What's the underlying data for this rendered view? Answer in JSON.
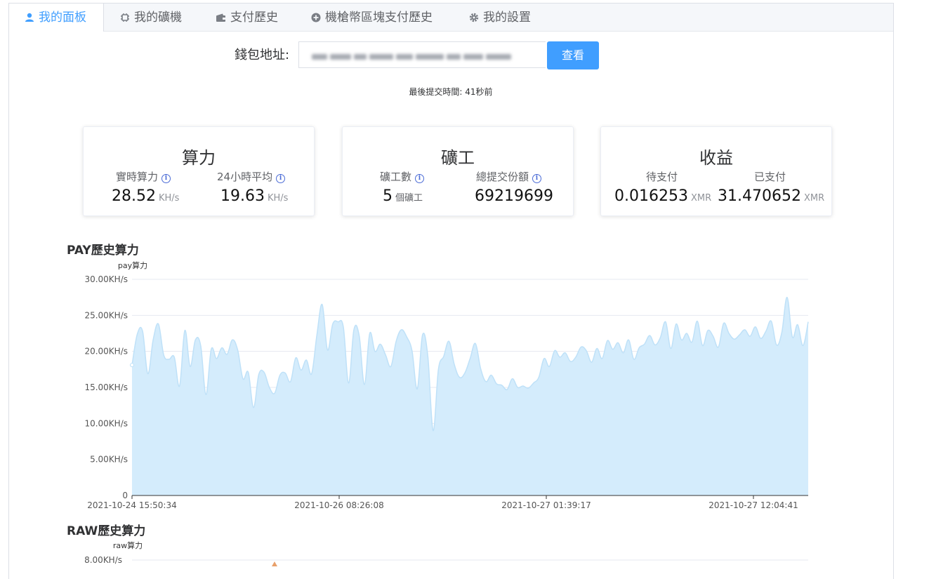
{
  "tabs": [
    {
      "label": "我的面板",
      "icon": "user-icon"
    },
    {
      "label": "我的礦機",
      "icon": "chip-icon"
    },
    {
      "label": "支付歷史",
      "icon": "wallet-icon"
    },
    {
      "label": "機槍幣區塊支付歷史",
      "icon": "plus-circle-icon"
    },
    {
      "label": "我的設置",
      "icon": "gear-icon"
    }
  ],
  "wallet": {
    "label": "錢包地址:",
    "button_label": "查看"
  },
  "last_submit": "最後提交時間: 41秒前",
  "cards": {
    "hashrate": {
      "title": "算力",
      "realtime_label": "實時算力",
      "realtime_value": "28.52",
      "realtime_unit": "KH/s",
      "avg_label": "24小時平均",
      "avg_value": "19.63",
      "avg_unit": "KH/s"
    },
    "miners": {
      "title": "礦工",
      "count_label": "礦工數",
      "count_value": "5",
      "count_unit": "個礦工",
      "shares_label": "總提交份額",
      "shares_value": "69219699"
    },
    "earnings": {
      "title": "收益",
      "pending_label": "待支付",
      "pending_value": "0.016253",
      "pending_unit": "XMR",
      "paid_label": "已支付",
      "paid_value": "31.470652",
      "paid_unit": "XMR"
    }
  },
  "colors": {
    "accent": "#409eff",
    "area_fill": "#d4ecfc",
    "area_line": "#bfe1f8"
  },
  "chart_data": [
    {
      "type": "area",
      "title": "PAY歷史算力",
      "series": [
        {
          "name": "pay算力",
          "values": [
            18.1,
            22.4,
            22.8,
            16.9,
            21.6,
            23.8,
            19.5,
            18.9,
            19.2,
            15.2,
            22.9,
            17.9,
            21.6,
            20.8,
            14.0,
            20.3,
            19.0,
            20.5,
            19.6,
            21.6,
            20.2,
            16.2,
            17.1,
            12.2,
            16.8,
            17.1,
            15.0,
            14.2,
            16.7,
            17.0,
            15.8,
            19.1,
            17.4,
            18.8,
            16.9,
            22.3,
            26.5,
            20.2,
            23.8,
            24.1,
            23.4,
            15.6,
            23.0,
            22.2,
            15.4,
            22.5,
            20.0,
            21.0,
            19.5,
            17.9,
            21.4,
            23.0,
            22.0,
            20.1,
            14.8,
            22.3,
            19.3,
            9.0,
            17.5,
            19.3,
            21.4,
            18.2,
            16.4,
            17.0,
            19.0,
            21.1,
            17.6,
            15.8,
            16.7,
            15.5,
            15.3,
            14.7,
            16.2,
            15.0,
            15.2,
            14.9,
            15.6,
            16.4,
            19.0,
            17.9,
            20.1,
            19.2,
            19.8,
            18.6,
            19.2,
            20.6,
            20.1,
            18.5,
            20.4,
            19.0,
            21.5,
            20.3,
            21.2,
            19.8,
            21.6,
            18.9,
            20.5,
            21.0,
            22.2,
            20.9,
            21.9,
            24.1,
            20.4,
            23.8,
            21.6,
            22.5,
            21.3,
            24.2,
            20.8,
            22.9,
            22.1,
            20.6,
            23.9,
            22.5,
            21.7,
            22.3,
            23.0,
            22.1,
            23.4,
            21.8,
            22.8,
            24.2,
            20.9,
            22.6,
            27.5,
            22.0,
            23.7,
            20.8,
            24.1
          ]
        }
      ],
      "x_tick_labels": [
        "2021-10-24 15:50:34",
        "2021-10-26 08:26:08",
        "2021-10-27 01:39:17",
        "2021-10-27 12:04:41"
      ],
      "y_tick_labels": [
        "0",
        "5.00KH/s",
        "10.00KH/s",
        "15.00KH/s",
        "20.00KH/s",
        "25.00KH/s",
        "30.00KH/s"
      ],
      "ylim": [
        0,
        30
      ],
      "grid": true
    },
    {
      "type": "area",
      "title": "RAW歷史算力",
      "series": [
        {
          "name": "raw算力",
          "values": []
        }
      ],
      "y_tick_labels": [
        "8.00KH/s"
      ],
      "grid": true
    }
  ]
}
